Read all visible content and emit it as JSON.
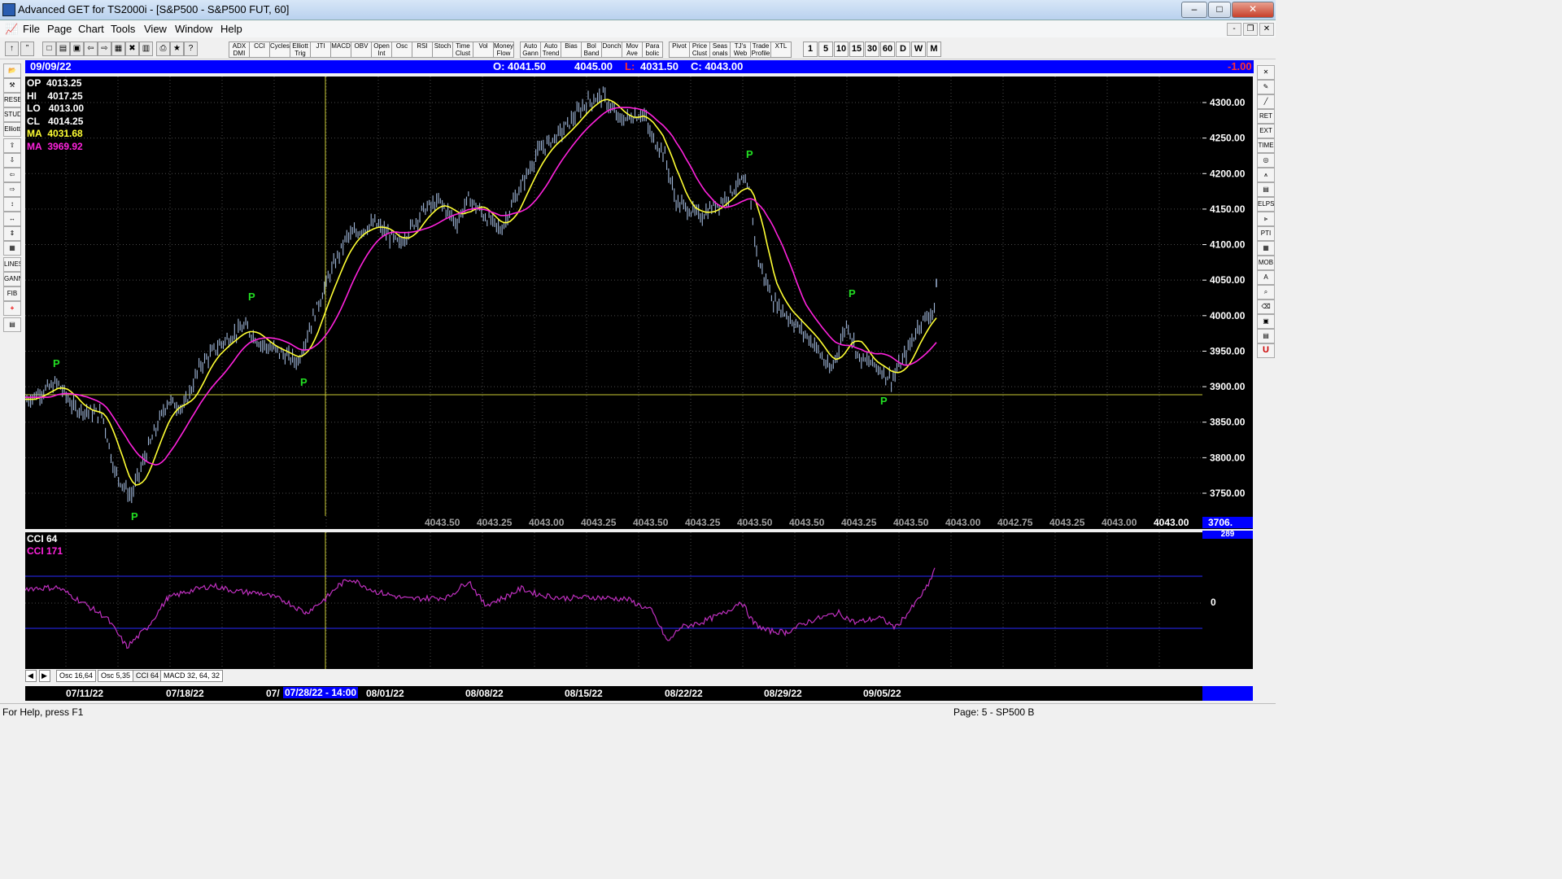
{
  "window": {
    "title": "Advanced GET for TS2000i - [S&P500 - S&P500 FUT, 60]",
    "min": "‒",
    "max": "□",
    "close": "✕"
  },
  "menu": [
    "File",
    "Page",
    "Chart",
    "Tools",
    "View",
    "Window",
    "Help"
  ],
  "mdi": {
    "min": "-",
    "restore": "❐",
    "close": "✕"
  },
  "toolbar": {
    "study_buttons": [
      "ADX DMI",
      "CCI",
      "Cycles",
      "Elliott Trig",
      "JTI",
      "MACD",
      "OBV",
      "Open Int",
      "Osc",
      "RSI",
      "Stoch",
      "Time Clust",
      "Vol",
      "Money Flow",
      "Auto Gann",
      "Auto Trend",
      "Bias",
      "Bol Band",
      "Donch",
      "Mov Ave",
      "Para bolic",
      "Pivot",
      "Price Clust",
      "Seas onals",
      "TJ's Web",
      "Trade Profile",
      "XTL"
    ],
    "timeframes": [
      "1",
      "5",
      "10",
      "15",
      "30",
      "60",
      "D",
      "W",
      "M"
    ]
  },
  "header": {
    "date": "09/09/22",
    "open": "O: 4041.50",
    "high": "4045.00",
    "low_label": "L:",
    "low": "4031.50",
    "close": "C: 4043.00",
    "change": "-1.00"
  },
  "info": {
    "op": {
      "label": "OP",
      "value": "4013.25"
    },
    "hi": {
      "label": "HI",
      "value": "4017.25"
    },
    "lo": {
      "label": "LO",
      "value": "4013.00"
    },
    "cl": {
      "label": "CL",
      "value": "4014.25"
    },
    "ma1": {
      "label": "MA",
      "value": "4031.68"
    },
    "ma2": {
      "label": "MA",
      "value": "3969.92"
    }
  },
  "colors": {
    "bars": "#9fb6d8",
    "ma_fast": "#ffff33",
    "ma_slow": "#ff22dd",
    "pivot": "#22dd22",
    "cci": "#c030c0",
    "band": "#2a2aff",
    "crosshair": "#c8c832"
  },
  "price_axis": {
    "ticks": [
      "4300.00",
      "4250.00",
      "4200.00",
      "4150.00",
      "4100.00",
      "4050.00",
      "4000.00",
      "3950.00",
      "3900.00",
      "3850.00",
      "3800.00",
      "3750.00"
    ],
    "current_tag": "3706."
  },
  "bottom_prices": [
    "4043.50",
    "4043.25",
    "4043.00",
    "4043.25",
    "4043.50",
    "4043.25",
    "4043.50",
    "4043.50",
    "4043.25",
    "4043.50",
    "4043.00",
    "4042.75",
    "4043.25",
    "4043.00",
    "4043.00"
  ],
  "pivot_label": "P",
  "cci_panel": {
    "title": "CCI 64",
    "value_label": "CCI  171",
    "axis_zero": "0",
    "axis_top_tag": "289"
  },
  "tabs": [
    "Osc 16,64",
    "Osc 5,35",
    "CCI 64",
    "MACD 32, 64, 32"
  ],
  "dates": {
    "labels": [
      "07/11/22",
      "07/18/22",
      "07/",
      "08/01/22",
      "08/08/22",
      "08/15/22",
      "08/22/22",
      "08/29/22",
      "09/05/22"
    ],
    "cursor": "07/28/22 - 14:00"
  },
  "status": {
    "left": "For Help, press F1",
    "right": "Page: 5 - SP500 B"
  }
}
